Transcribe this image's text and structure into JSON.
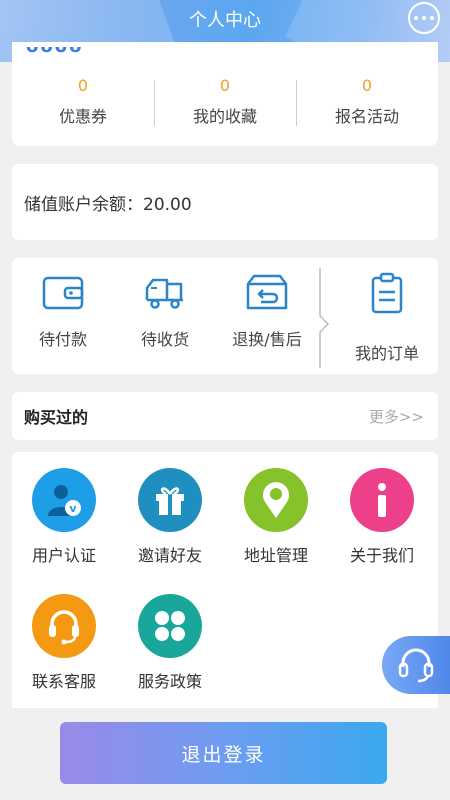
{
  "header": {
    "title": "个人中心"
  },
  "stats": [
    {
      "value": "0",
      "label": "优惠券"
    },
    {
      "value": "0",
      "label": "我的收藏"
    },
    {
      "value": "0",
      "label": "报名活动"
    }
  ],
  "balance": {
    "text": "储值账户余额：20.00"
  },
  "orders": {
    "items": [
      {
        "label": "待付款",
        "icon": "wallet-icon"
      },
      {
        "label": "待收货",
        "icon": "truck-icon"
      },
      {
        "label": "退换/售后",
        "icon": "return-box-icon"
      }
    ],
    "my_orders": {
      "label": "我的订单",
      "icon": "clipboard-icon"
    }
  },
  "bought": {
    "title": "购买过的",
    "more": "更多>>"
  },
  "services": [
    {
      "label": "用户认证",
      "icon": "user-verify-icon",
      "color": "#1f9ee8"
    },
    {
      "label": "邀请好友",
      "icon": "gift-icon",
      "color": "#1f8fbf"
    },
    {
      "label": "地址管理",
      "icon": "location-pin-icon",
      "color": "#86c22a"
    },
    {
      "label": "关于我们",
      "icon": "info-icon",
      "color": "#ee3f8a"
    },
    {
      "label": "联系客服",
      "icon": "headset-icon",
      "color": "#f39a12"
    },
    {
      "label": "服务政策",
      "icon": "clover-icon",
      "color": "#1aa79b"
    }
  ],
  "logout": {
    "label": "退出登录"
  }
}
